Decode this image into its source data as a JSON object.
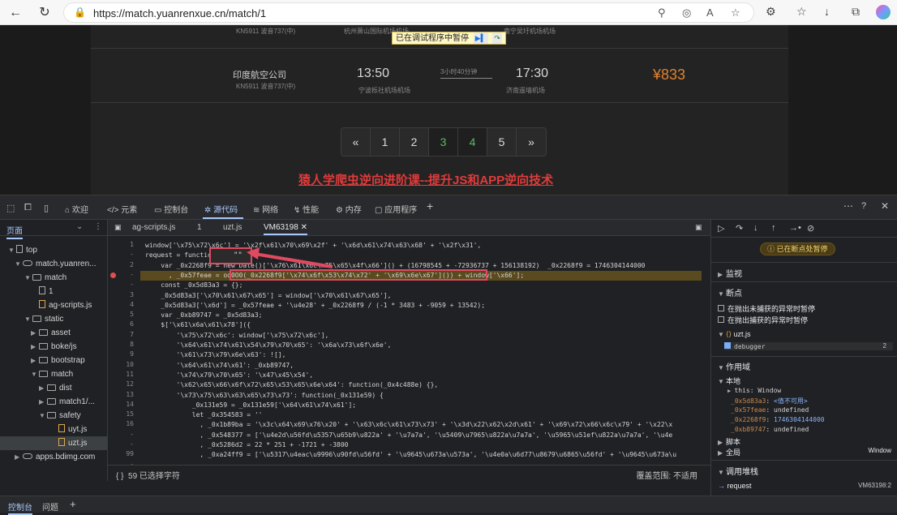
{
  "browser": {
    "url": "https://match.yuanrenxue.cn/match/1"
  },
  "page": {
    "top_flight": {
      "flight_no": "KN5911 波音737(中)",
      "from_airport": "杭州萧山国际机场机场",
      "to_airport": "南宁吴圩机场机场"
    },
    "flight": {
      "airline": "印度航空公司",
      "flight_no": "KN5911 波音737(中)",
      "depart_time": "13:50",
      "depart_airport": "宁波栎社机场机场",
      "duration": "3小时40分钟",
      "arrive_time": "17:30",
      "arrive_airport": "济南遥墙机场",
      "price": "¥833"
    },
    "debug_banner": "已在调试程序中暂停",
    "pager": [
      "«",
      "1",
      "2",
      "3",
      "4",
      "5",
      "»"
    ],
    "promo_link": "猿人学爬虫逆向进阶课--提升JS和APP逆向技术"
  },
  "devtools": {
    "tabs": [
      "欢迎",
      "元素",
      "控制台",
      "源代码",
      "网络",
      "性能",
      "内存",
      "应用程序"
    ],
    "navigator": {
      "header": "页面",
      "tree": [
        "top",
        "match.yuanren...",
        "match",
        "1",
        "ag-scripts.js",
        "static",
        "asset",
        "boke/js",
        "bootstrap",
        "match",
        "dist",
        "match1/...",
        "safety",
        "uyt.js",
        "uzt.js",
        "apps.bdimg.com"
      ]
    },
    "editor_tabs": [
      "ag-scripts.js",
      "1",
      "uzt.js",
      "VM63198"
    ],
    "line_numbers": [
      "1",
      "-",
      "2",
      "-",
      "-",
      "3",
      "4",
      "5",
      "6",
      "7",
      "8",
      "9",
      "10",
      "11",
      "12",
      "13",
      "14",
      "15",
      "16",
      "-",
      "-",
      "99",
      "-"
    ],
    "code": [
      "window['\\x75\\x72\\x6c'] = '\\x2f\\x61\\x70\\x69\\x2f' + '\\x6d\\x61\\x74\\x63\\x68' + '\\x2f\\x31',",
      "request = function() {",
      "    var _0x2268f9 = new Date()['\\x76\\x61\\x6c\\x75\\x65\\x4f\\x66']() + (16798545 + -72936737 + 156138192)  _0x2268f9 = 1746304144000",
      "      , _0x57feae = oo0O0(_0x2268f9['\\x74\\x6f\\x53\\x74\\x72' + '\\x69\\x6e\\x67']()) + window['\\x66'];",
      "    const _0x5d83a3 = {};",
      "    _0x5d83a3['\\x70\\x61\\x67\\x65'] = window['\\x70\\x61\\x67\\x65'],",
      "    _0x5d83a3['\\x6d'] = _0x57feae + '\\u4e28' + _0x2268f9 / (-1 * 3483 + -9059 + 13542);",
      "    var _0xb89747 = _0x5d83a3;",
      "    $['\\x61\\x6a\\x61\\x78']({",
      "        '\\x75\\x72\\x6c': window['\\x75\\x72\\x6c'],",
      "        '\\x64\\x61\\x74\\x61\\x54\\x79\\x70\\x65': '\\x6a\\x73\\x6f\\x6e',",
      "        '\\x61\\x73\\x79\\x6e\\x63': ![],",
      "        '\\x64\\x61\\x74\\x61': _0xb89747,",
      "        '\\x74\\x79\\x70\\x65': '\\x47\\x45\\x54',",
      "        '\\x62\\x65\\x66\\x6f\\x72\\x65\\x53\\x65\\x6e\\x64': function(_0x4c488e) {},",
      "        '\\x73\\x75\\x63\\x63\\x65\\x73\\x73': function(_0x131e59) {",
      "            _0x131e59 = _0x131e59['\\x64\\x61\\x74\\x61'];",
      "            let _0x354583 = ''",
      "              , _0x1b89ba = '\\x3c\\x64\\x69\\x76\\x20' + '\\x63\\x6c\\x61\\x73\\x73' + '\\x3d\\x22\\x62\\x2d\\x61' + '\\x69\\x72\\x66\\x6c\\x79' + '\\x22\\x",
      "              , _0x548377 = ['\\u4e2d\\u56fd\\u5357\\u65b9\\u822a' + '\\u7a7a', '\\u5409\\u7965\\u822a\\u7a7a', '\\u5965\\u51ef\\u822a\\u7a7a', '\\u4e",
      "              , _0x5286d2 = 22 * 251 + -1721 + -3800",
      "              , _0xa24ff9 = ['\\u5317\\u4eac\\u9996\\u90fd\\u56fd' + '\\u9645\\u673a\\u573a', '\\u4e0a\\u6d77\\u8679\\u6865\\u56fd' + '\\u9645\\u673a\\u"
    ],
    "popup_value": "\"\"",
    "status_left": "59 已选择字符",
    "status_right": "覆盖范围: 不适用",
    "sidebar": {
      "paused": "已在断点处暂停",
      "watch": "监视",
      "breakpoints": "断点",
      "bp_uncaught": "在抛出未捕获的异常时暂停",
      "bp_caught": "在抛出捕获的异常时暂停",
      "bp_file": "uzt.js",
      "bp_line": "debugger",
      "bp_line_no": "2",
      "scope": "作用域",
      "local": "本地",
      "this_name": "this",
      "this_value": "Window",
      "var1_name": "_0x5d83a3",
      "var1_value": "<值不可用>",
      "var2_name": "_0x57feae",
      "var2_value": "undefined",
      "var3_name": "_0x2268f9",
      "var3_value": "1746304144000",
      "var4_name": "_0xb89747",
      "var4_value": "undefined",
      "script": "脚本",
      "global": "全局",
      "global_value": "Window",
      "callstack": "调用堆栈",
      "frame_name": "request",
      "frame_loc": "VM63198:2"
    },
    "drawer": [
      "控制台",
      "问题"
    ]
  }
}
